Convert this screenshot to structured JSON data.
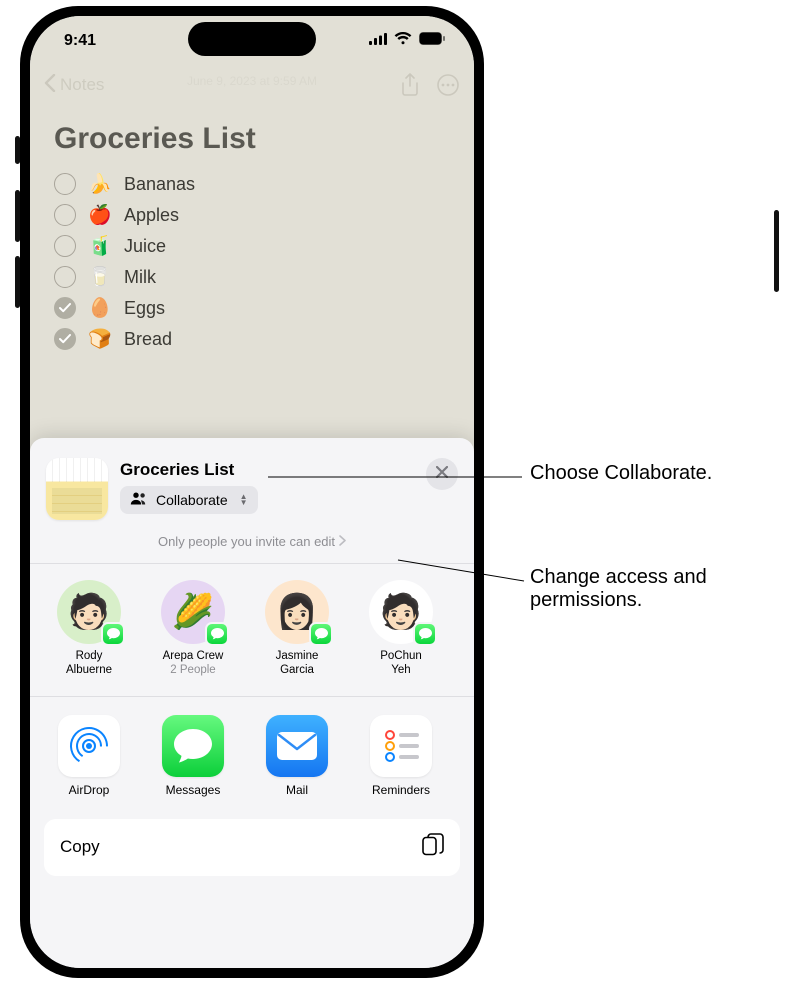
{
  "status": {
    "time": "9:41"
  },
  "nav": {
    "back_label": "Notes",
    "date_text": "June 9, 2023 at 9:59 AM"
  },
  "note": {
    "title": "Groceries List",
    "items": [
      {
        "emoji": "🍌",
        "label": "Bananas",
        "checked": false
      },
      {
        "emoji": "🍎",
        "label": "Apples",
        "checked": false
      },
      {
        "emoji": "🧃",
        "label": "Juice",
        "checked": false
      },
      {
        "emoji": "🥛",
        "label": "Milk",
        "checked": false
      },
      {
        "emoji": "🥚",
        "label": "Eggs",
        "checked": true
      },
      {
        "emoji": "🍞",
        "label": "Bread",
        "checked": true
      }
    ]
  },
  "share": {
    "title": "Groceries List",
    "mode_label": "Collaborate",
    "permissions_text": "Only people you invite can edit",
    "contacts": [
      {
        "name": "Rody Albuerne",
        "sub": "",
        "color": "#d8efc9",
        "emoji": "🧑🏻"
      },
      {
        "name": "Arepa Crew",
        "sub": "2 People",
        "color": "#e6d6f3",
        "emoji": "🌽"
      },
      {
        "name": "Jasmine Garcia",
        "sub": "",
        "color": "#fde6cd",
        "emoji": "👩🏻"
      },
      {
        "name": "PoChun Yeh",
        "sub": "",
        "color": "#ffffff",
        "emoji": "🧑🏻"
      }
    ],
    "apps": [
      {
        "label": "AirDrop",
        "key": "airdrop"
      },
      {
        "label": "Messages",
        "key": "messages"
      },
      {
        "label": "Mail",
        "key": "mail"
      },
      {
        "label": "Reminders",
        "key": "reminders"
      }
    ],
    "actions": {
      "copy_label": "Copy"
    }
  },
  "callouts": {
    "collaborate": "Choose Collaborate.",
    "permissions": "Change access and permissions."
  }
}
